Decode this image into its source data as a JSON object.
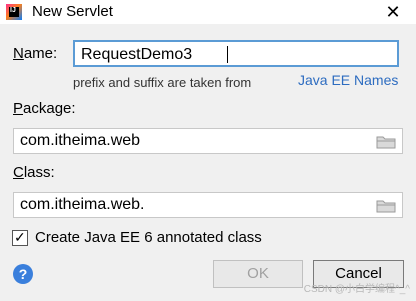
{
  "window": {
    "title": "New Servlet"
  },
  "icons": {
    "app": "intellij-idea-icon",
    "close": "close-icon",
    "browse": "folder-icon",
    "help": "help-icon"
  },
  "name": {
    "prefix": "N",
    "rest": "ame:",
    "value": "RequestDemo3"
  },
  "hint": {
    "text": "prefix and suffix are taken from",
    "link": "Java EE Names"
  },
  "package": {
    "prefix": "P",
    "rest": "ackage:",
    "value": "com.itheima.web"
  },
  "class": {
    "prefix": "C",
    "rest": "lass:",
    "value": "com.itheima.web."
  },
  "annotated": {
    "label": "Create Java EE 6 annotated class",
    "checked": true
  },
  "buttons": {
    "ok": "OK",
    "cancel": "Cancel"
  },
  "help_glyph": "?",
  "watermark": "CSDN @小白学编程^_^",
  "colors": {
    "accent": "#5b9bd5",
    "link": "#2d6cc0",
    "help": "#3a7fdc"
  }
}
